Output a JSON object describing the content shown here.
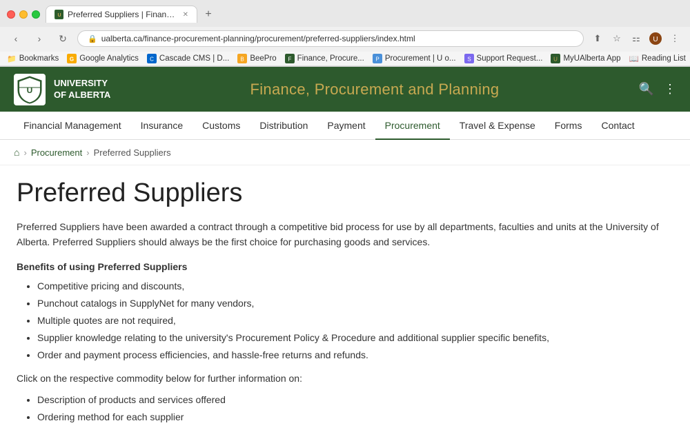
{
  "browser": {
    "tab": {
      "title": "Preferred Suppliers | Finance, ...",
      "favicon_label": "PS"
    },
    "address": "ualberta.ca/finance-procurement-planning/procurement/preferred-suppliers/index.html",
    "new_tab_icon": "+",
    "nav": {
      "back": "‹",
      "forward": "›",
      "refresh": "↻",
      "home": "⌂"
    }
  },
  "bookmarks": [
    {
      "id": "bookmarks-folder",
      "label": "Bookmarks",
      "type": "folder"
    },
    {
      "id": "google-analytics",
      "label": "Google Analytics",
      "type": "link"
    },
    {
      "id": "cascade-cms",
      "label": "Cascade CMS | D...",
      "type": "link"
    },
    {
      "id": "beepro",
      "label": "BeePro",
      "type": "link"
    },
    {
      "id": "finance-procure",
      "label": "Finance, Procure...",
      "type": "link"
    },
    {
      "id": "procurement-u",
      "label": "Procurement | U o...",
      "type": "link"
    },
    {
      "id": "support-request",
      "label": "Support Request...",
      "type": "link"
    },
    {
      "id": "myualberta",
      "label": "MyUAlberta App",
      "type": "link"
    },
    {
      "id": "reading-list",
      "label": "Reading List",
      "type": "link"
    }
  ],
  "university": {
    "name_line1": "UNIVERSITY",
    "name_line2": "OF ALBERTA",
    "dept_title": "Finance, Procurement and Planning",
    "search_icon": "🔍",
    "menu_icon": "⋮"
  },
  "nav": {
    "items": [
      {
        "id": "financial-management",
        "label": "Financial Management",
        "active": false
      },
      {
        "id": "insurance",
        "label": "Insurance",
        "active": false
      },
      {
        "id": "customs",
        "label": "Customs",
        "active": false
      },
      {
        "id": "distribution",
        "label": "Distribution",
        "active": false
      },
      {
        "id": "payment",
        "label": "Payment",
        "active": false
      },
      {
        "id": "procurement",
        "label": "Procurement",
        "active": true
      },
      {
        "id": "travel-expense",
        "label": "Travel & Expense",
        "active": false
      },
      {
        "id": "forms",
        "label": "Forms",
        "active": false
      },
      {
        "id": "contact",
        "label": "Contact",
        "active": false
      }
    ]
  },
  "breadcrumb": {
    "home_icon": "⌂",
    "items": [
      "Procurement",
      "Preferred Suppliers"
    ]
  },
  "content": {
    "page_title": "Preferred Suppliers",
    "intro": "Preferred Suppliers have been awarded a contract through a competitive bid process for use by all departments, faculties and units at the University of Alberta. Preferred Suppliers should always be the first choice for purchasing goods and services.",
    "benefits_heading": "Benefits of using Preferred Suppliers",
    "benefits": [
      "Competitive pricing and discounts,",
      "Punchout catalogs in SupplyNet for many vendors,",
      "Multiple quotes are not required,",
      "Supplier knowledge relating to the university's Procurement Policy & Procedure and additional supplier specific benefits,",
      "Order and payment process efficiencies, and hassle-free returns and refunds."
    ],
    "click_text": "Click on the respective commodity below for further information on:",
    "further_info": [
      "Description of products and services offered",
      "Ordering method for each supplier"
    ]
  }
}
